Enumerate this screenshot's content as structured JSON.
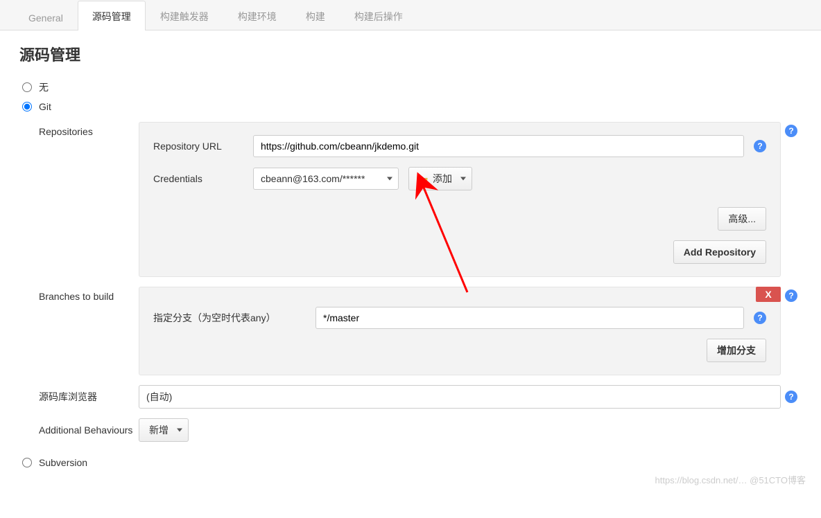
{
  "tabs": {
    "general": "General",
    "scm": "源码管理",
    "triggers": "构建触发器",
    "env": "构建环境",
    "build": "构建",
    "post": "构建后操作"
  },
  "page_title": "源码管理",
  "scm_options": {
    "none": "无",
    "git": "Git",
    "svn": "Subversion"
  },
  "repo_section_label": "Repositories",
  "repo": {
    "url_label": "Repository URL",
    "url_value": "https://github.com/cbeann/jkdemo.git",
    "cred_label": "Credentials",
    "cred_value": "cbeann@163.com/******",
    "add_btn": "添加",
    "advanced_btn": "高级...",
    "add_repo_btn": "Add Repository"
  },
  "branches_section_label": "Branches to build",
  "branches": {
    "branch_label": "指定分支（为空时代表any）",
    "branch_value": "*/master",
    "add_branch_btn": "增加分支",
    "delete_x": "X"
  },
  "browser_section_label": "源码库浏览器",
  "browser_value": "(自动)",
  "behaviours_section_label": "Additional Behaviours",
  "behaviours_add_btn": "新增",
  "help_glyph": "?",
  "watermark": "https://blog.csdn.net/… @51CTO博客"
}
